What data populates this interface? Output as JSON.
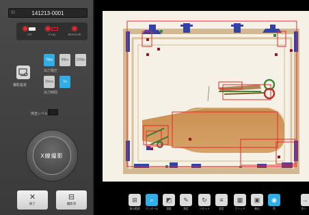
{
  "header": {
    "id_prefix": "ID",
    "patient_id": "141213-0001"
  },
  "status": [
    {
      "label": "Ctrl",
      "kind": "led-battery"
    },
    {
      "label": "X-ray",
      "kind": "led-battery-empty"
    },
    {
      "label": "Bluetooth",
      "kind": "led"
    }
  ],
  "controls": {
    "mode_label": "撮影設定",
    "voltage_options": [
      {
        "label": "70kv",
        "selected": true
      },
      {
        "label": "80kv",
        "selected": false
      },
      {
        "label": "100kv",
        "selected": false
      }
    ],
    "voltage_label": "出力電圧",
    "time_options": [
      {
        "label": "20ms",
        "selected": false
      },
      {
        "label": "1s",
        "selected": true
      }
    ],
    "time_label": "出力時間",
    "level_label": "検査レベル",
    "shoot_label": "X線撮影"
  },
  "bottom_buttons": {
    "end_icon": "✕",
    "end_label": "終了",
    "scan_icon": "⊟",
    "scan_label": "撮影済"
  },
  "toolbar": [
    {
      "icon": "grid-icon",
      "glyph": "⊞",
      "label": "指示範囲",
      "selected": false
    },
    {
      "icon": "zoom-icon",
      "glyph": "⌕",
      "label": "パンズーム",
      "selected": true
    },
    {
      "icon": "contrast-icon",
      "glyph": "◩",
      "label": "濃度",
      "selected": false
    },
    {
      "icon": "measure-icon",
      "glyph": "✎",
      "label": "測定",
      "selected": false
    },
    {
      "icon": "reset-icon",
      "glyph": "↻",
      "label": "リセット",
      "selected": false
    },
    {
      "icon": "settings-icon",
      "glyph": "≡",
      "label": "設定",
      "selected": false
    },
    {
      "icon": "grid-overlay-icon",
      "glyph": "▦",
      "label": "グリッド",
      "selected": false
    },
    {
      "icon": "export-icon",
      "glyph": "▣",
      "label": "抽出",
      "selected": false
    },
    {
      "icon": "color-icon",
      "glyph": "◉",
      "label": "色",
      "selected": true
    }
  ],
  "next_button": {
    "glyph": "→",
    "label": "次へ"
  },
  "colors": {
    "accent": "#31aee8",
    "detect_box": "#e8262a",
    "led": "#e8262a"
  }
}
